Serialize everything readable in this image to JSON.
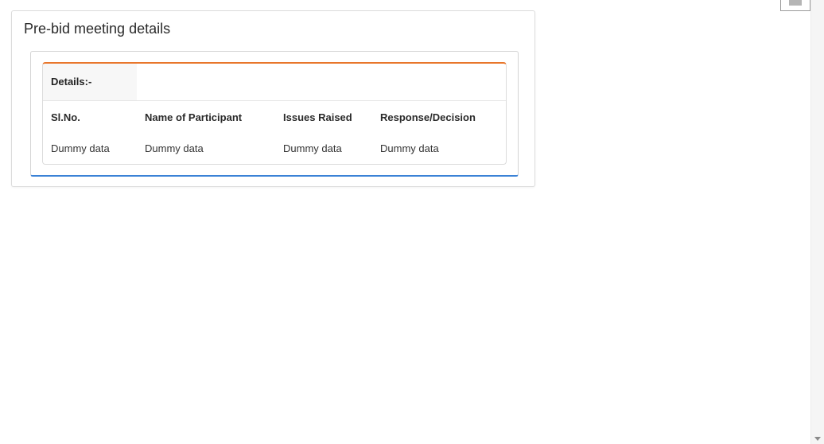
{
  "panel": {
    "title": "Pre-bid meeting details"
  },
  "details": {
    "label": "Details:-",
    "columns": [
      "Sl.No.",
      "Name of Participant",
      "Issues Raised",
      "Response/Decision"
    ],
    "rows": [
      [
        "Dummy data",
        "Dummy data",
        "Dummy data",
        "Dummy data"
      ]
    ]
  },
  "colors": {
    "card_top_accent": "#e8762b",
    "panel_bottom_accent": "#3b82d6"
  },
  "icons": {
    "scroll_down": "chevron-down-icon",
    "corner_widget": "minimize-icon"
  }
}
